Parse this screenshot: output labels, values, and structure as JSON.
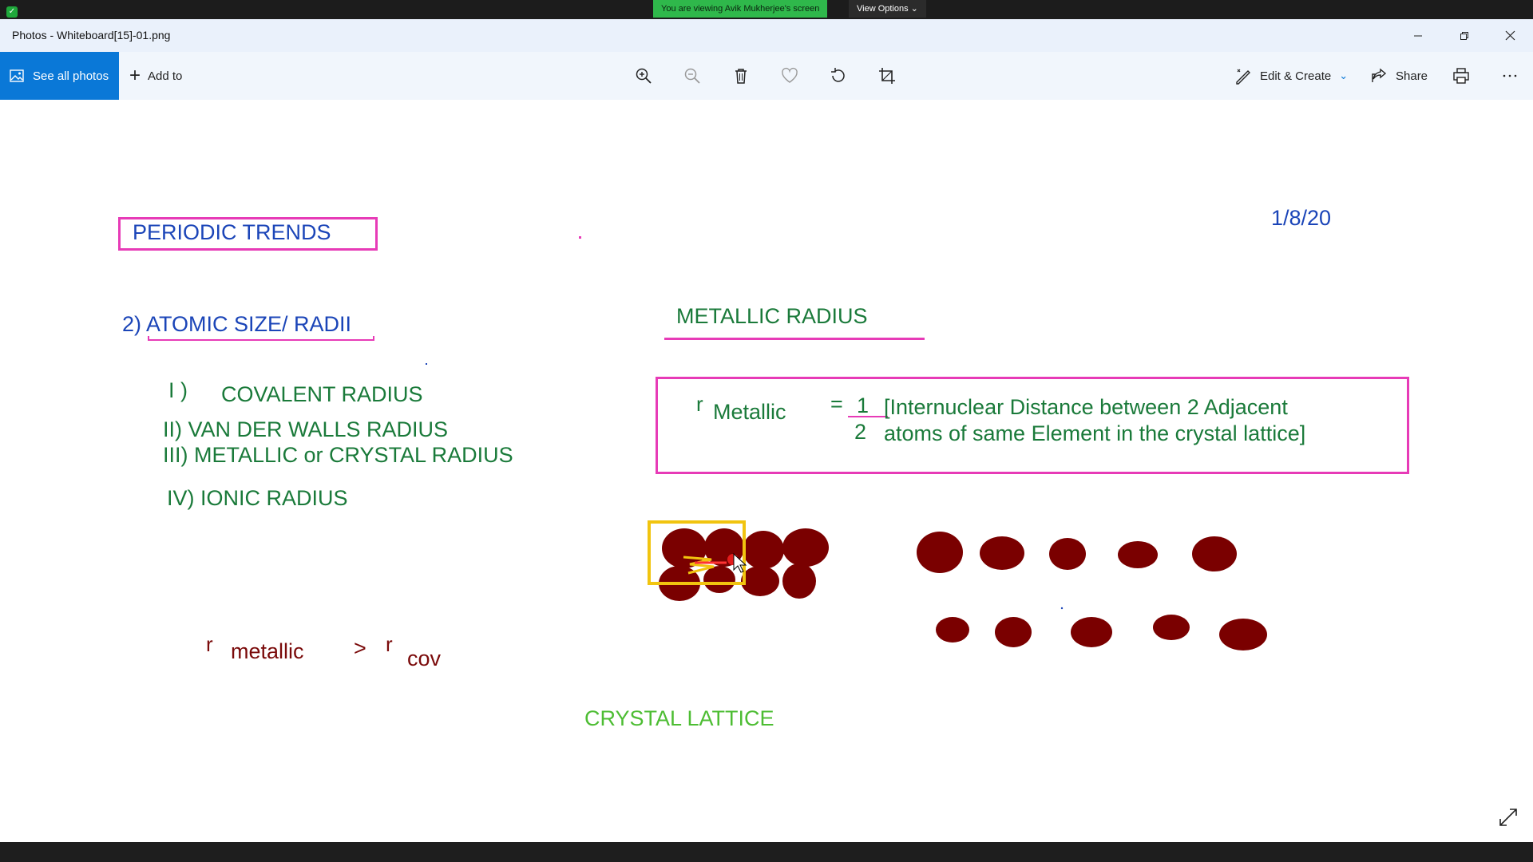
{
  "share_banner": {
    "viewing_text": "You are viewing Avik Mukherjee's screen",
    "view_options_label": "View Options"
  },
  "window": {
    "title": "Photos - Whiteboard[15]-01.png"
  },
  "toolbar": {
    "see_all_photos": "See all photos",
    "add_to": "Add to",
    "edit_create": "Edit & Create",
    "share": "Share",
    "icons": [
      "zoom-in-icon",
      "zoom-out-icon",
      "trash-icon",
      "heart-icon",
      "rotate-icon",
      "crop-icon",
      "print-icon",
      "more-icon"
    ]
  },
  "whiteboard": {
    "title": "PERIODIC TRENDS",
    "date": "1/8/20",
    "section": "2) ATOMIC SIZE/ RADII",
    "list": {
      "i": "I )",
      "i_text": "COVALENT RADIUS",
      "ii": "II) VAN DER WALLS RADIUS",
      "iii": "III) METALLIC or CRYSTAL  RADIUS",
      "iv": "IV) IONIC RADIUS"
    },
    "metallic_heading": "METALLIC RADIUS",
    "formula": {
      "r": "r",
      "sub": "Metallic",
      "equals": "=",
      "numerator": "1",
      "denominator": "2",
      "line1": "[Internuclear Distance between  2 Adjacent",
      "line2": "atoms of same Element in the crystal lattice]"
    },
    "comparison": {
      "r1": "r",
      "sub1": "metallic",
      "gt": ">",
      "r2": "r",
      "sub2": "cov"
    },
    "caption": "CRYSTAL LATTICE"
  },
  "colors": {
    "accent": "#0a78d7",
    "pink": "#e73bb7",
    "blue_ink": "#1b45b8",
    "green_ink": "#1a7a3a",
    "maroon": "#7a0000",
    "yellow": "#f1c40f"
  }
}
